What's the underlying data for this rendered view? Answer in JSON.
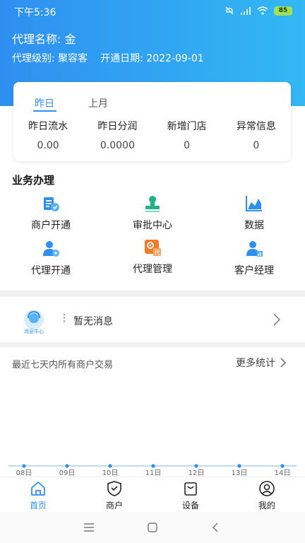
{
  "status_bar": {
    "time": "下午5:36",
    "battery": "85"
  },
  "agent": {
    "name": "代理名称: 金",
    "level": "代理级别: 聚容客",
    "open_date": "开通日期: 2022-09-01"
  },
  "summary": {
    "tabs": [
      {
        "label": "昨日"
      },
      {
        "label": "上月"
      }
    ],
    "stats": [
      {
        "label": "昨日流水",
        "value": "0.00"
      },
      {
        "label": "昨日分润",
        "value": "0.0000"
      },
      {
        "label": "新增门店",
        "value": "0"
      },
      {
        "label": "异常信息",
        "value": "0"
      }
    ]
  },
  "business": {
    "title": "业务办理",
    "items": [
      {
        "label": "商户开通",
        "icon": "merchant-open-icon"
      },
      {
        "label": "审批中心",
        "icon": "approval-stamp-icon"
      },
      {
        "label": "数据",
        "icon": "data-chart-icon"
      },
      {
        "label": "代理开通",
        "icon": "agent-open-icon"
      },
      {
        "label": "代理管理",
        "icon": "agent-manage-icon"
      },
      {
        "label": "客户经理",
        "icon": "account-manager-icon"
      }
    ]
  },
  "messages": {
    "center_label": "消息中心",
    "text": "暂无消息"
  },
  "recent": {
    "title": "最近七天内所有商户交易",
    "more_label": "更多统计"
  },
  "chart_data": {
    "type": "line",
    "categories": [
      "08日",
      "09日",
      "10日",
      "11日",
      "12日",
      "13日",
      "14日"
    ],
    "values": [
      0,
      0,
      0,
      0,
      0,
      0,
      0
    ]
  },
  "tabbar": {
    "items": [
      {
        "label": "首页",
        "active": true
      },
      {
        "label": "商户",
        "active": false
      },
      {
        "label": "设备",
        "active": false
      },
      {
        "label": "我的",
        "active": false
      }
    ]
  },
  "colors": {
    "brand": "#2f8ff0",
    "gradient_end": "#33b8f4",
    "orange": "#f07a2a",
    "green": "#23b08a"
  }
}
